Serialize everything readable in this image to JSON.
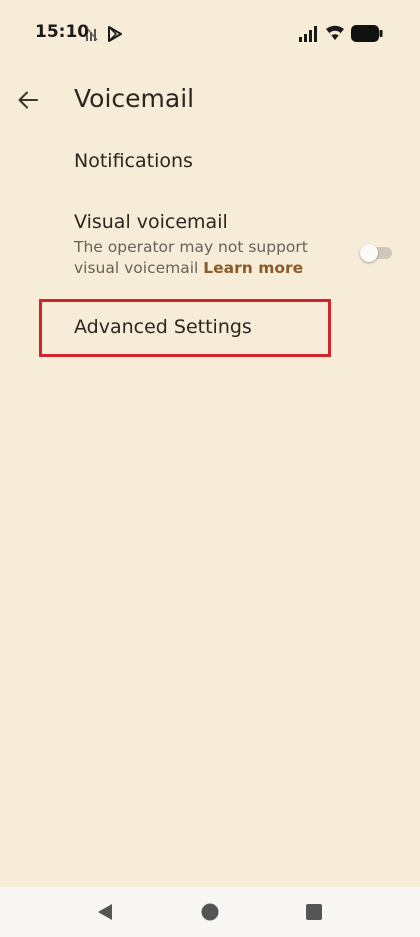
{
  "status_bar": {
    "time": "15:10",
    "icons": [
      "data-saver-icon",
      "play-store-icon",
      "signal-icon",
      "wifi-icon",
      "battery-icon"
    ]
  },
  "header": {
    "title": "Voicemail",
    "back_icon": "arrow-back-icon"
  },
  "settings": {
    "notifications": {
      "title": "Notifications"
    },
    "visual_voicemail": {
      "title": "Visual voicemail",
      "summary": "The operator may not support visual voicemail",
      "link": "Learn more",
      "enabled": false
    },
    "advanced": {
      "title": "Advanced Settings"
    }
  },
  "colors": {
    "background": "#f6ecd7",
    "accent_link": "#8a5a2b",
    "highlight": "#d3232f"
  },
  "nav": {
    "buttons": [
      "back-triangle-icon",
      "home-circle-icon",
      "recents-square-icon"
    ]
  }
}
